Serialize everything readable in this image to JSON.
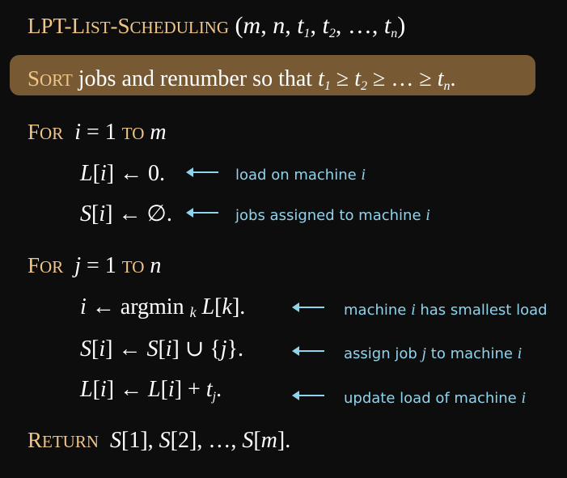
{
  "header": {
    "kw_prefix": "LPT-L",
    "kw_small1": "IST",
    "kw_sep": "-S",
    "kw_small2": "CHEDULING",
    "params_open": "(",
    "p_m": "m",
    "p_sep1": ", ",
    "p_n": "n",
    "p_sep2": ", ",
    "p_t": "t",
    "p_sub1": "1",
    "p_sep3": ", ",
    "p_t2": "t",
    "p_sub2": "2",
    "p_sep4": ", …, ",
    "p_tn": "t",
    "p_subn": "n",
    "params_close": ")"
  },
  "sort_line": {
    "kw_cap": "S",
    "kw_small": "ORT",
    "text": " jobs and renumber so that ",
    "t": "t",
    "s1": "1",
    "ge1": " ≥ ",
    "t2": "t",
    "s2": "2",
    "ge2": " ≥ … ≥ ",
    "tn": "t",
    "sn": "n",
    "end": "."
  },
  "for1": {
    "kw_cap": "F",
    "kw_small": "OR",
    "var": "i",
    "eq": " = 1 ",
    "to": "TO",
    "bound": "m"
  },
  "line_L": {
    "arr": "L",
    "open": "[",
    "idx": "i",
    "close": "] ← 0.",
    "comment": "load on machine ",
    "comment_var": "i"
  },
  "line_S": {
    "arr": "S",
    "open": "[",
    "idx": "i",
    "close": "] ← ∅.",
    "comment": "jobs assigned to machine ",
    "comment_var": "i"
  },
  "for2": {
    "kw_cap": "F",
    "kw_small": "OR",
    "var": "j",
    "eq": " = 1 ",
    "to": "TO",
    "bound": "n"
  },
  "line_argmin": {
    "lhs": "i",
    "arrow": " ← argmin ",
    "k": "k",
    "arr": " L",
    "open": "[",
    "idx": "k",
    "close": "].",
    "comment_pre": "machine ",
    "comment_var": "i",
    "comment_post": " has smallest load"
  },
  "line_union": {
    "arr": "S",
    "open": "[",
    "idx": "i",
    "mid": "] ← ",
    "arr2": "S",
    "open2": "[",
    "idx2": "i",
    "mid2": "]  ∪  {",
    "j": "j",
    "close": "}.",
    "comment_pre": "assign job ",
    "comment_var1": "j",
    "comment_mid": " to machine ",
    "comment_var2": "i"
  },
  "line_update": {
    "arr": "L",
    "open": "[",
    "idx": "i",
    "mid": "] ← ",
    "arr2": "L",
    "open2": "[",
    "idx2": "i",
    "mid2": "] + ",
    "t": "t",
    "sub": "j",
    "end": ".",
    "comment_pre": "update load of machine ",
    "comment_var": "i"
  },
  "return_line": {
    "kw_cap": "R",
    "kw_small": "ETURN",
    "s1": "S",
    "b1": "[1], ",
    "s2": "S",
    "b2": "[2], …, ",
    "s3": "S",
    "b3o": "[",
    "m": "m",
    "b3c": "]."
  }
}
